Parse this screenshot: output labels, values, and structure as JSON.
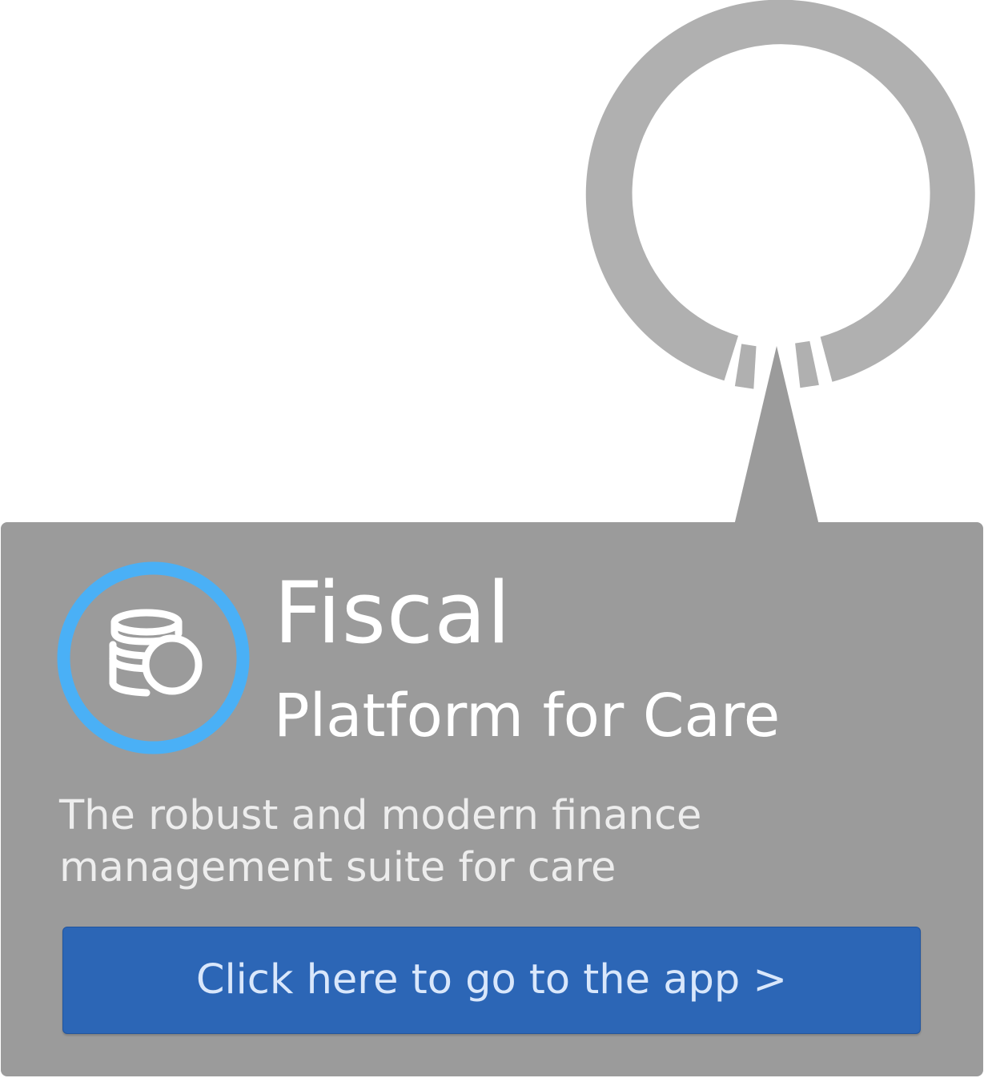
{
  "app": {
    "name": "Fiscal",
    "subtitle": "Platform for Care",
    "description": "The robust and modern finance management suite for care"
  },
  "cta": {
    "label": "Click here to go to the app >"
  },
  "icons": {
    "app_icon": "coins-icon",
    "decoration": "location-ring-pin-icon"
  },
  "colors": {
    "panel": "#9b9b9b",
    "ring": "#b0b0b0",
    "icon_ring": "#4ab0f6",
    "button": "#2c66b6",
    "button_text": "#d9e7fb"
  }
}
